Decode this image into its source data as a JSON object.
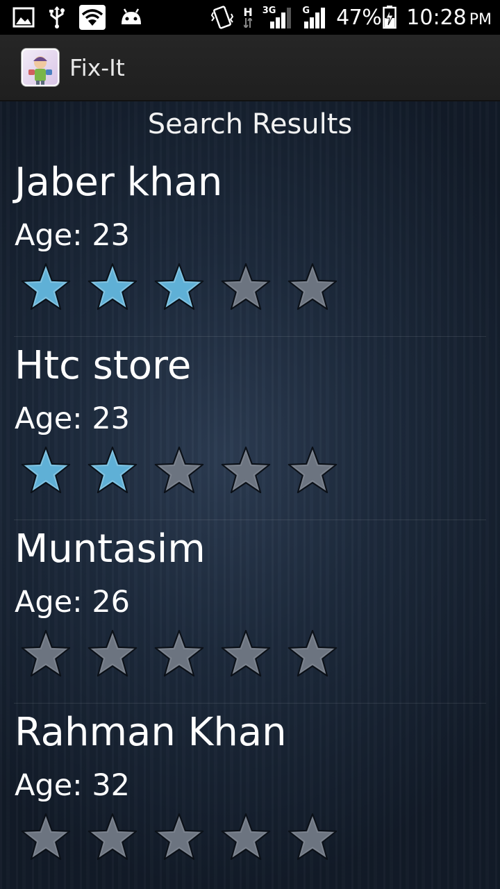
{
  "status_bar": {
    "icons": [
      "image-icon",
      "usb-icon",
      "wifi-icon",
      "android-icon",
      "vibrate-icon",
      "h-network-icon",
      "signal-3g-icon",
      "signal-g-icon",
      "battery-charging-icon"
    ],
    "net_h": "H",
    "net_3g": "3G",
    "net_g": "G",
    "battery": "47%",
    "time": "10:28",
    "ampm": "PM"
  },
  "app": {
    "title": "Fix-It"
  },
  "page": {
    "heading": "Search Results"
  },
  "results": [
    {
      "name": "Jaber khan",
      "age": "Age: 23",
      "rating": 3,
      "max_rating": 5
    },
    {
      "name": "Htc store",
      "age": "Age: 23",
      "rating": 2,
      "max_rating": 5
    },
    {
      "name": "Muntasim",
      "age": "Age: 26",
      "rating": 0,
      "max_rating": 5
    },
    {
      "name": "Rahman Khan",
      "age": "Age: 32",
      "rating": 0,
      "max_rating": 5
    }
  ],
  "colors": {
    "star_filled": "#5fb0d6",
    "star_empty": "#6c7480",
    "text": "#ffffff"
  }
}
